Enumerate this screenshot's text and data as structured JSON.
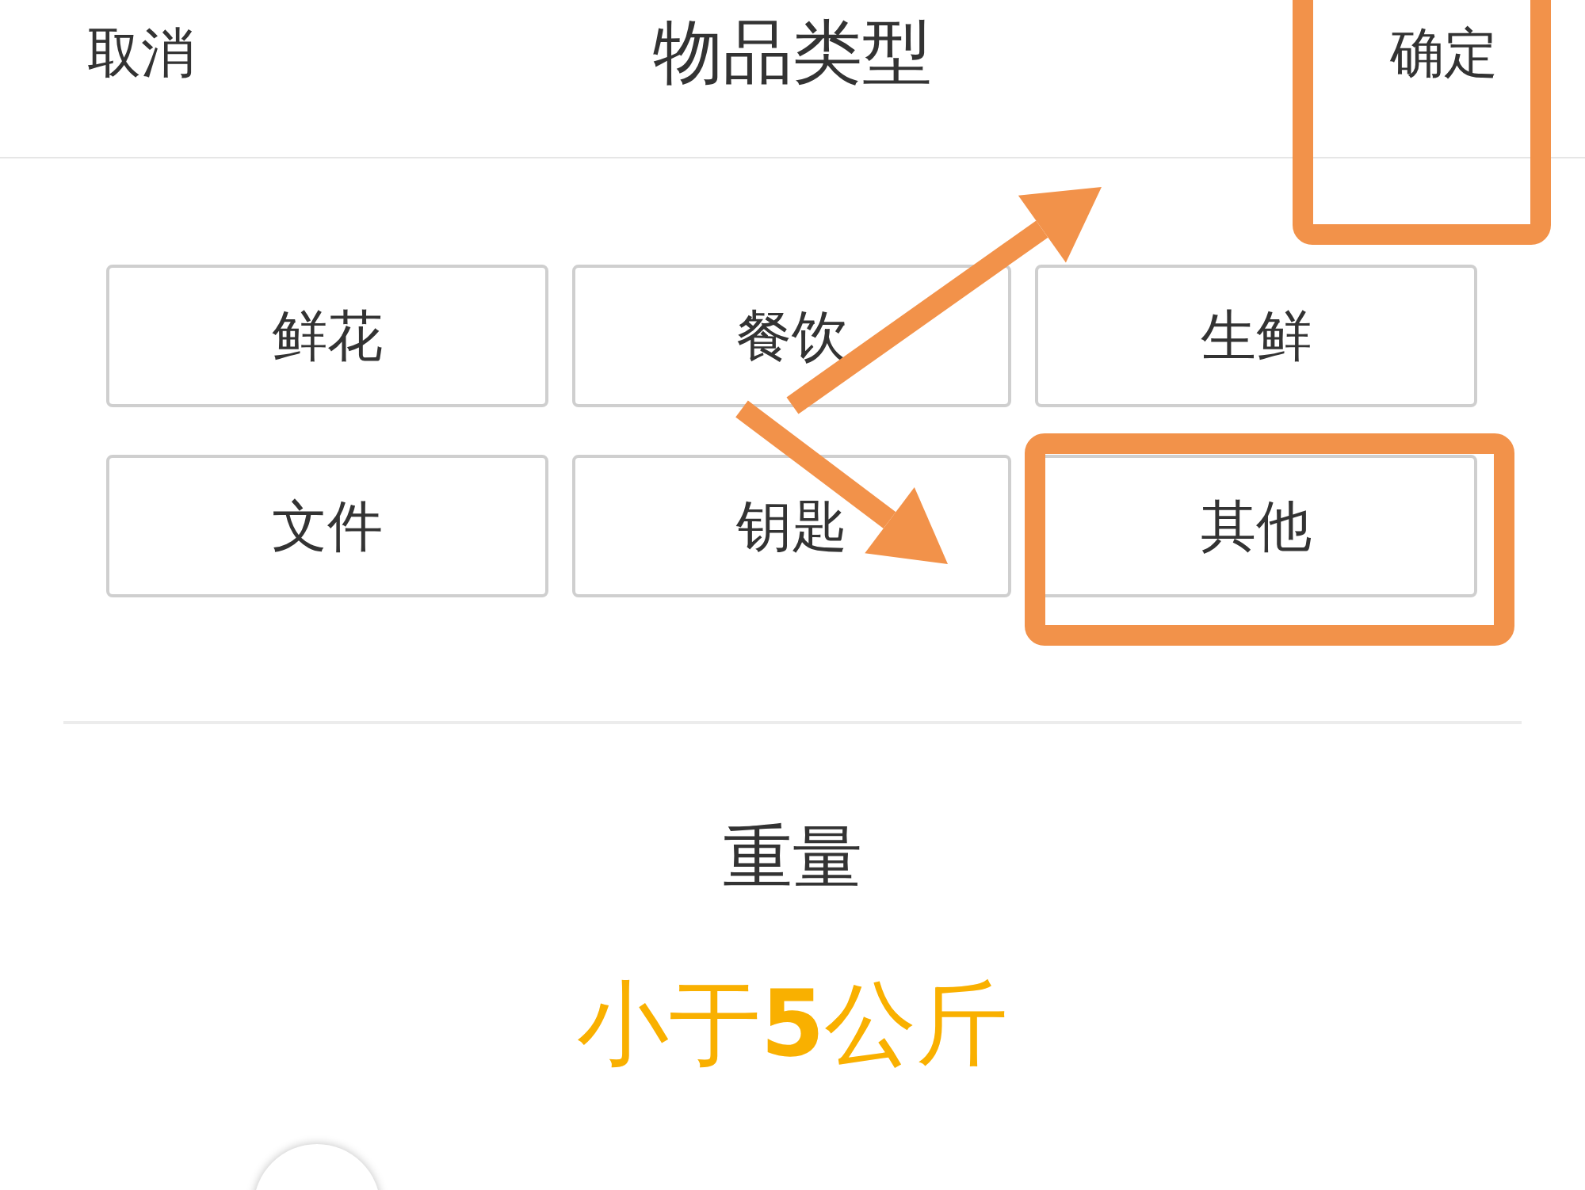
{
  "header": {
    "cancel": "取消",
    "title": "物品类型",
    "confirm": "确定"
  },
  "item_types": [
    {
      "label": "鲜花"
    },
    {
      "label": "餐饮"
    },
    {
      "label": "生鲜"
    },
    {
      "label": "文件"
    },
    {
      "label": "钥匙"
    },
    {
      "label": "其他"
    }
  ],
  "weight": {
    "label": "重量",
    "value": "小于**5**公斤"
  },
  "annotations": [
    {
      "kind": "box"
    },
    {
      "kind": "box"
    },
    {
      "kind": "arrow"
    },
    {
      "kind": "arrow"
    }
  ]
}
